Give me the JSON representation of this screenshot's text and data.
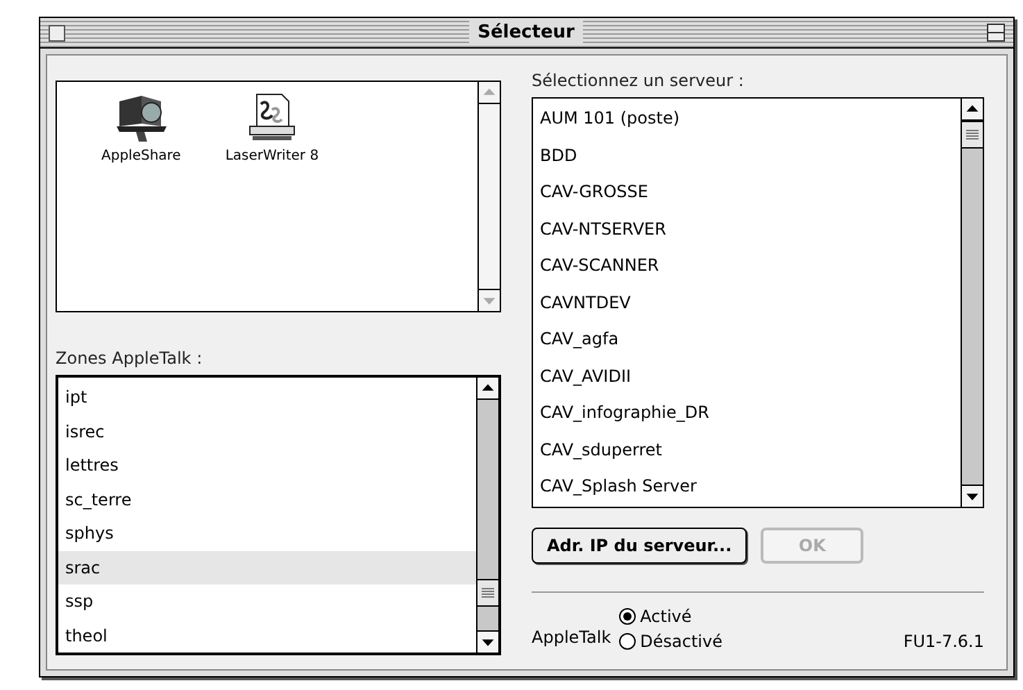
{
  "window": {
    "title": "Sélecteur"
  },
  "devices": [
    {
      "label": "AppleShare",
      "kind": "fileserver",
      "selected": false
    },
    {
      "label": "LaserWriter 8",
      "kind": "printer",
      "selected": false
    }
  ],
  "zones": {
    "label": "Zones AppleTalk :",
    "items": [
      {
        "label": "ipt",
        "selected": false
      },
      {
        "label": "isrec",
        "selected": false
      },
      {
        "label": "lettres",
        "selected": false
      },
      {
        "label": "sc_terre",
        "selected": false
      },
      {
        "label": "sphys",
        "selected": false
      },
      {
        "label": "srac",
        "selected": true
      },
      {
        "label": "ssp",
        "selected": false
      },
      {
        "label": "theol",
        "selected": false
      }
    ]
  },
  "servers": {
    "label": "Sélectionnez un serveur :",
    "items": [
      {
        "label": "AUM 101 (poste)",
        "selected": false
      },
      {
        "label": "BDD",
        "selected": false
      },
      {
        "label": "CAV-GROSSE",
        "selected": false
      },
      {
        "label": "CAV-NTSERVER",
        "selected": false
      },
      {
        "label": "CAV-SCANNER",
        "selected": false
      },
      {
        "label": "CAVNTDEV",
        "selected": false
      },
      {
        "label": "CAV_agfa",
        "selected": false
      },
      {
        "label": "CAV_AVIDII",
        "selected": false
      },
      {
        "label": "CAV_infographie_DR",
        "selected": false
      },
      {
        "label": "CAV_sduperret",
        "selected": false
      },
      {
        "label": "CAV_Splash Server",
        "selected": false
      }
    ]
  },
  "buttons": [
    {
      "label": "Adr. IP du serveur...",
      "disabled": false
    },
    {
      "label": "OK",
      "disabled": true
    }
  ],
  "appletalk": {
    "label": "AppleTalk",
    "options": [
      {
        "label": "Activé",
        "selected": true
      },
      {
        "label": "Désactivé",
        "selected": false
      }
    ]
  },
  "version": "FU1-7.6.1"
}
